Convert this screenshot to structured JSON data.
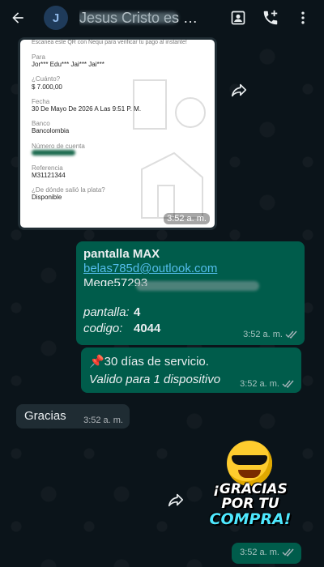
{
  "header": {
    "avatar_letter": "J",
    "contact_name": "Jesus Cristo es m..."
  },
  "receipt": {
    "note": "Escanea este QR con Nequi para verificar tu pago al instante!",
    "para_label": "Para",
    "para_value": "Jor*** Edu*** Jai*** Jai***",
    "cuanto_label": "¿Cuánto?",
    "cuanto_value": "$ 7.000,00",
    "fecha_label": "Fecha",
    "fecha_value": "30 De Mayo De 2026 A Las 9:51 P. M.",
    "banco_label": "Banco",
    "banco_value": "Bancolombia",
    "cuenta_label": "Número de cuenta",
    "referencia_label": "Referencia",
    "referencia_value": "M31121344",
    "origen_label": "¿De dónde salió la plata?",
    "origen_value": "Disponible",
    "time": "3:52 a. m."
  },
  "messages": [
    {
      "line1": "pantalla  MAX",
      "line2": "belas785d@outlook.com",
      "line3": "Mege572930",
      "line4_label": "pantalla:",
      "line4_value": "4",
      "line5_label": "codigo:",
      "line5_value": "4044",
      "time": "3:52 a. m."
    },
    {
      "line1": "📌30 días de servicio.",
      "line2": "Valido para 1 dispositivo",
      "time": "3:52 a. m."
    },
    {
      "text": "Gracias",
      "time": "3:52 a. m."
    }
  ],
  "sticker": {
    "line1": "¡GRACIAS POR TU",
    "line2": "COMPRA!",
    "time": "3:52 a. m."
  },
  "colors": {
    "background": "#0b141a",
    "outgoing_bubble": "#005c4b",
    "incoming_bubble": "#1f2c33",
    "link": "#53bdeb"
  }
}
